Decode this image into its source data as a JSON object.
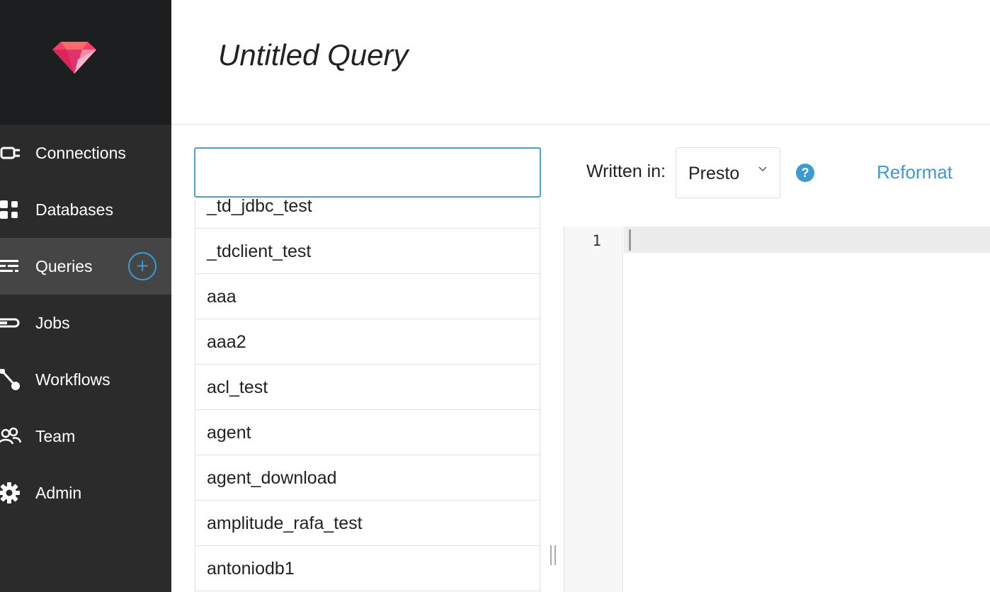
{
  "sidebar": {
    "items": [
      {
        "label": "Connections",
        "icon": "plug-icon"
      },
      {
        "label": "Databases",
        "icon": "grid-icon"
      },
      {
        "label": "Queries",
        "icon": "list-icon"
      },
      {
        "label": "Jobs",
        "icon": "progress-icon"
      },
      {
        "label": "Workflows",
        "icon": "workflow-icon"
      },
      {
        "label": "Team",
        "icon": "team-icon"
      },
      {
        "label": "Admin",
        "icon": "gear-icon"
      }
    ],
    "add_label": "+"
  },
  "header": {
    "title": "Untitled Query"
  },
  "database_selector": {
    "value": "",
    "options": [
      "_td_jdbc_test",
      "_tdclient_test",
      "aaa",
      "aaa2",
      "acl_test",
      "agent",
      "agent_download",
      "amplitude_rafa_test",
      "antoniodb1"
    ]
  },
  "toolbar": {
    "written_in_label": "Written in:",
    "language": "Presto",
    "help_label": "?",
    "reformat_label": "Reformat"
  },
  "editor": {
    "line_number": "1"
  },
  "colors": {
    "accent": "#3d9bd1",
    "sidebar_bg": "#2b2b2b",
    "sidebar_top": "#1c1e1f",
    "active_bg": "#454545"
  }
}
